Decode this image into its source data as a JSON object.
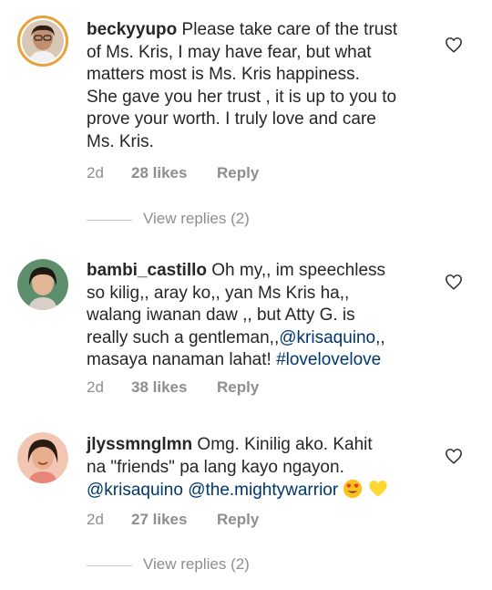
{
  "comments": [
    {
      "username": "beckyyupo",
      "text_lines": [
        " Please take care of the trust",
        "of Ms. Kris, I may have fear, but what",
        "matters most is Ms. Kris happiness.",
        "She gave you her trust , it is up to you to",
        "prove your worth. I truly love and care",
        "Ms. Kris."
      ],
      "time": "2d",
      "likes": "28 likes",
      "reply": "Reply",
      "view_replies": "View replies (2)"
    },
    {
      "username": "bambi_castillo",
      "line1": " Oh my,, im speechless",
      "line2": "so kilig,, aray ko,, yan Ms Kris ha,,",
      "line3": "walang iwanan daw ,, but Atty G. is",
      "line4_pre": "really such a gentleman,,",
      "mention": "@krisaquino",
      "line4_post": ",,",
      "line5_pre": "masaya nanaman lahat! ",
      "hashtag": "#lovelovelove",
      "time": "2d",
      "likes": "38 likes",
      "reply": "Reply"
    },
    {
      "username": "jlyssmnglmn",
      "line1": " Omg. Kinilig ako. Kahit",
      "line2": "na \"friends\" pa lang kayo ngayon.",
      "mention1": "@krisaquino",
      "mention2": "@the.mightywarrior",
      "emojis": [
        "heart-eyes-emoji",
        "yellow-heart-emoji"
      ],
      "time": "2d",
      "likes": "27 likes",
      "reply": "Reply",
      "view_replies": "View replies (2)"
    }
  ],
  "colors": {
    "link": "#00376b",
    "meta": "#8e8e8e",
    "ring": "#e9a23b"
  }
}
